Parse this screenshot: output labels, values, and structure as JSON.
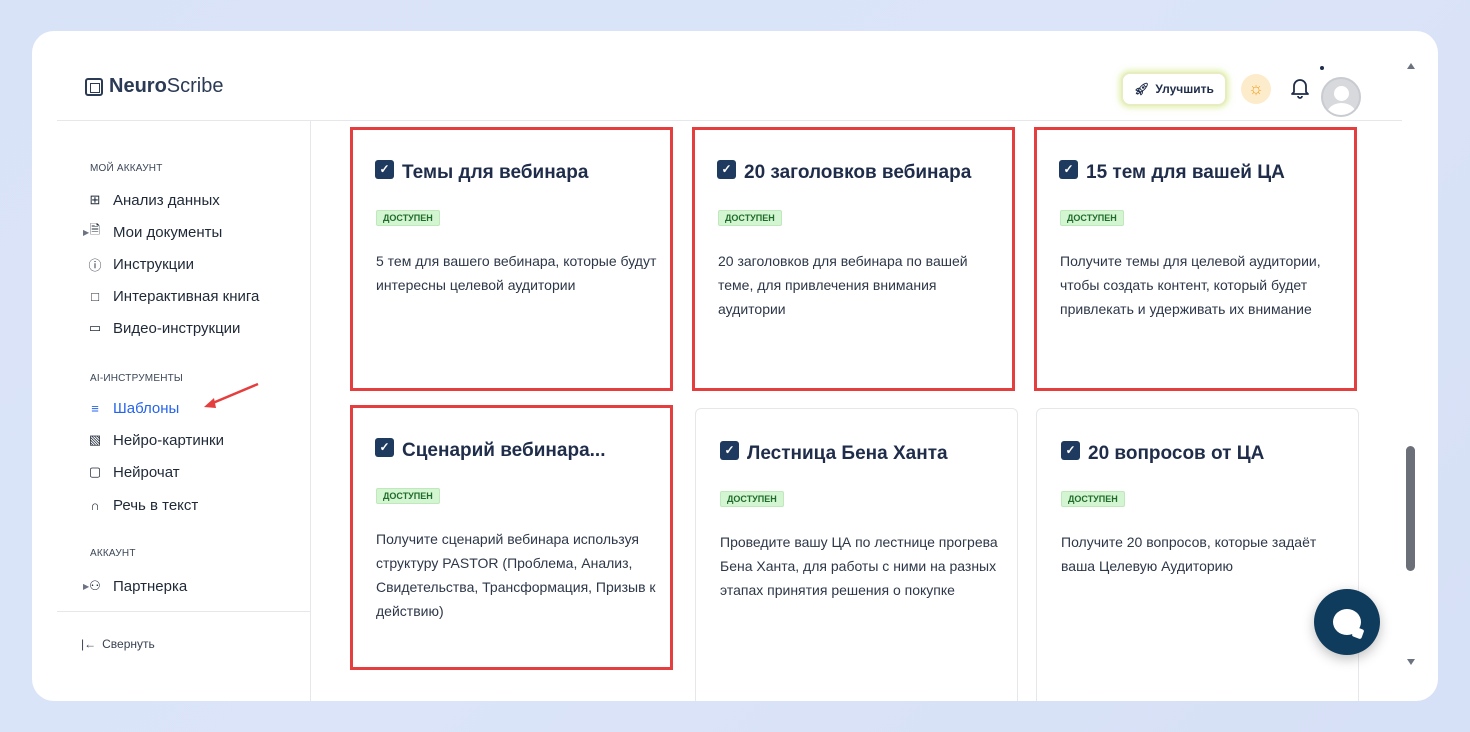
{
  "header": {
    "logo_bold": "Neuro",
    "logo_rest": "Scribe",
    "upgrade_label": "Улучшить"
  },
  "sidebar": {
    "section_account": "МОЙ АККАУНТ",
    "items_account": [
      {
        "label": "Анализ данных",
        "icon": "grid-icon"
      },
      {
        "label": "Мои документы",
        "icon": "document-icon"
      },
      {
        "label": "Инструкции",
        "icon": "help-circle-icon"
      },
      {
        "label": "Интерактивная книга",
        "icon": "book-icon"
      },
      {
        "label": "Видео-инструкции",
        "icon": "video-icon"
      }
    ],
    "section_ai": "AI-ИНСТРУМЕНТЫ",
    "items_ai": [
      {
        "label": "Шаблоны",
        "icon": "layers-icon"
      },
      {
        "label": "Нейро-картинки",
        "icon": "image-icon"
      },
      {
        "label": "Нейрочат",
        "icon": "chat-icon"
      },
      {
        "label": "Речь в текст",
        "icon": "headphones-icon"
      }
    ],
    "section_acc": "АККАУНТ",
    "items_acc": [
      {
        "label": "Партнерка",
        "icon": "users-icon"
      }
    ],
    "collapse_label": "Свернуть"
  },
  "cards": [
    {
      "title": "Темы для вебинара",
      "badge": "ДОСТУПЕН",
      "desc": "5 тем для вашего вебинара, которые будут интересны целевой аудитории"
    },
    {
      "title": "20 заголовков вебинара",
      "badge": "ДОСТУПЕН",
      "desc": "20 заголовков для вебинара по вашей теме, для привлечения внимания аудитории"
    },
    {
      "title": "15 тем для вашей ЦА",
      "badge": "ДОСТУПЕН",
      "desc": "Получите темы для целевой аудитории, чтобы создать контент, который будет привлекать и удерживать их внимание"
    },
    {
      "title": "Сценарий вебинара...",
      "badge": "ДОСТУПЕН",
      "desc": "Получите сценарий вебинара используя структуру PASTOR (Проблема, Анализ, Свидетельства, Трансформация, Призыв к действию)"
    },
    {
      "title": "Лестница Бена Ханта",
      "badge": "ДОСТУПЕН",
      "desc": "Проведите вашу ЦА по лестнице прогрева Бена Ханта, для работы с ними на разных этапах принятия решения о покупке"
    },
    {
      "title": "20 вопросов от ЦА",
      "badge": "ДОСТУПЕН",
      "desc": "Получите 20 вопросов, которые задаёт ваша Целевую Аудиторию"
    }
  ],
  "colors": {
    "highlight": "#e53e3e",
    "active_nav": "#2563eb",
    "badge_bg": "#d3f5d1",
    "chat_button": "#0f3b5c"
  }
}
